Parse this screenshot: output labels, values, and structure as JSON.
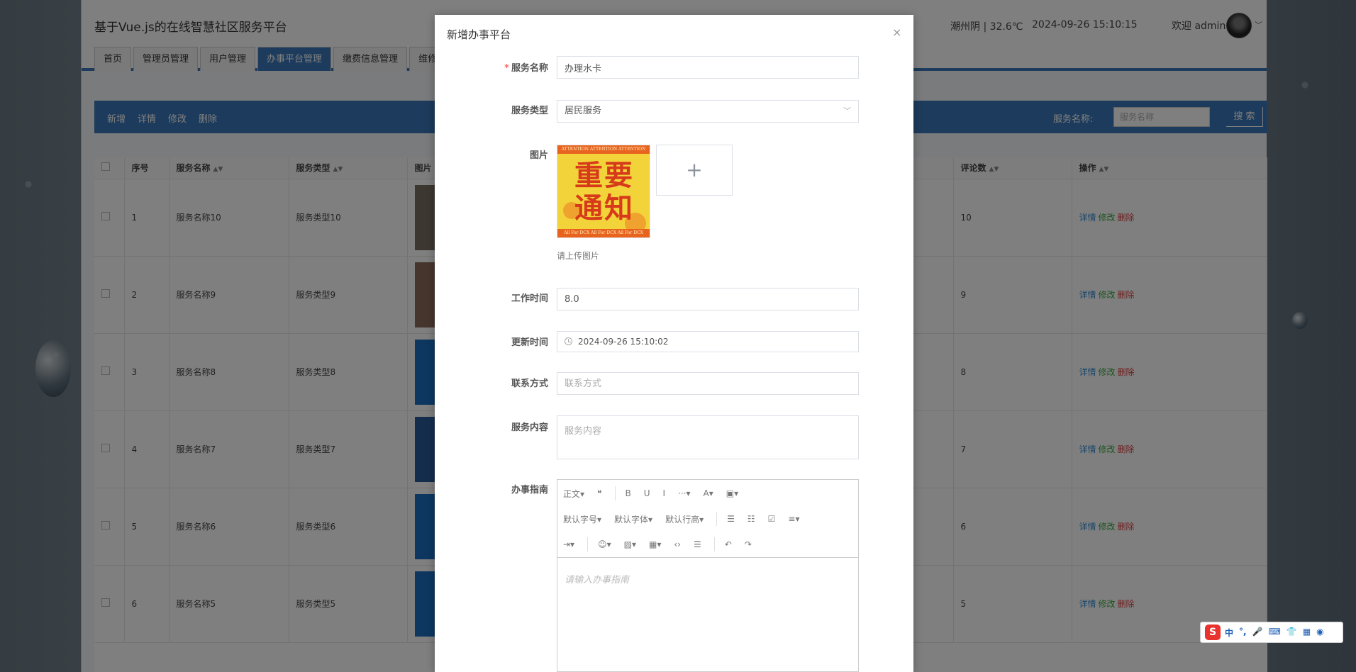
{
  "app": {
    "title": "基于Vue.js的在线智慧社区服务平台",
    "weather": "潮州阴 | 32.6℃",
    "clock": "2024-09-26  15:10:15",
    "welcome": "欢迎 admin",
    "tabs": [
      "首页",
      "管理员管理",
      "用户管理",
      "办事平台管理",
      "缴费信息管理",
      "维修信息管理"
    ],
    "active_tab": 3
  },
  "toolbar": {
    "add": "新增",
    "detail": "详情",
    "edit": "修改",
    "delete": "删除",
    "search_label": "服务名称:",
    "search_placeholder": "服务名称",
    "search_button": "搜 索"
  },
  "table": {
    "headers": {
      "index": "序号",
      "name": "服务名称",
      "type": "服务类型",
      "image": "图片",
      "comments": "评论数",
      "action": "操作"
    },
    "rows": [
      {
        "index": "1",
        "name": "服务名称10",
        "type": "服务类型10",
        "comments": "10"
      },
      {
        "index": "2",
        "name": "服务名称9",
        "type": "服务类型9",
        "comments": "9"
      },
      {
        "index": "3",
        "name": "服务名称8",
        "type": "服务类型8",
        "comments": "8"
      },
      {
        "index": "4",
        "name": "服务名称7",
        "type": "服务类型7",
        "comments": "7"
      },
      {
        "index": "5",
        "name": "服务名称6",
        "type": "服务类型6",
        "comments": "6"
      },
      {
        "index": "6",
        "name": "服务名称5",
        "type": "服务类型5",
        "comments": "5"
      }
    ],
    "actions": {
      "detail": "详情",
      "edit": "修改",
      "delete": "删除"
    }
  },
  "modal": {
    "title": "新增办事平台",
    "close": "×",
    "fields": {
      "name": {
        "label": "服务名称",
        "value": "办理水卡"
      },
      "type": {
        "label": "服务类型",
        "value": "居民服务"
      },
      "image": {
        "label": "图片",
        "hint": "请上传图片",
        "add": "+"
      },
      "work_time": {
        "label": "工作时间",
        "value": "8.0"
      },
      "update_time": {
        "label": "更新时间",
        "value": "2024-09-26 15:10:02"
      },
      "contact": {
        "label": "联系方式",
        "placeholder": "联系方式"
      },
      "content": {
        "label": "服务内容",
        "placeholder": "服务内容"
      },
      "guide": {
        "label": "办事指南",
        "placeholder": "请输入办事指南"
      }
    },
    "image_preview": {
      "strip": "ATTENTION  ATTENTION  ATTENTION",
      "strip_bottom": "All For DCX   All For DCX   All For DCX",
      "text": "重要通知"
    },
    "editor_toolbar": {
      "row1": [
        "正文▾",
        "❝",
        "B",
        "U",
        "I",
        "···▾",
        "A▾",
        "▣▾"
      ],
      "row2": [
        "默认字号▾",
        "默认字体▾",
        "默认行高▾",
        "☰",
        "☷",
        "☑",
        "≡▾"
      ],
      "row3": [
        "⇥▾",
        "☺▾",
        "▨▾",
        "▦▾",
        "‹›",
        "☰",
        "↶",
        "↷"
      ]
    }
  },
  "ime": {
    "logo": "S",
    "items": [
      "中",
      "°,",
      "🎤",
      "⌨",
      "👕",
      "▦",
      "◉"
    ]
  }
}
